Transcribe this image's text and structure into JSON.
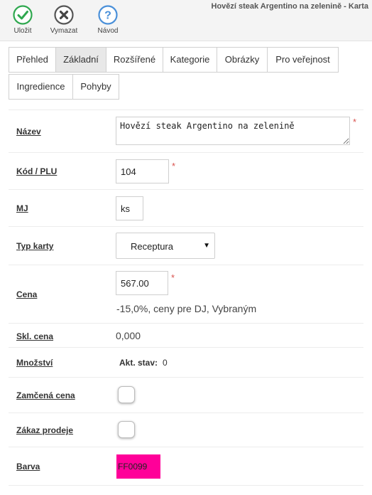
{
  "window": {
    "title": "Hovězí steak Argentino na zelenině - Karta"
  },
  "toolbar": {
    "save_label": "Uložit",
    "delete_label": "Vymazat",
    "help_label": "Návod"
  },
  "tabs": [
    {
      "label": "Přehled",
      "active": false
    },
    {
      "label": "Základní",
      "active": true
    },
    {
      "label": "Rozšířené",
      "active": false
    },
    {
      "label": "Kategorie",
      "active": false
    },
    {
      "label": "Obrázky",
      "active": false
    },
    {
      "label": "Pro veřejnost",
      "active": false
    },
    {
      "label": "Ingredience",
      "active": false
    },
    {
      "label": "Pohyby",
      "active": false
    }
  ],
  "form": {
    "name": {
      "label": "Název",
      "value": "Hovězí steak Argentino na zelenině",
      "required_mark": "*"
    },
    "code": {
      "label": "Kód / PLU",
      "value": "104",
      "required_mark": "*"
    },
    "unit": {
      "label": "MJ",
      "value": "ks"
    },
    "card_type": {
      "label": "Typ karty",
      "value": "Receptura",
      "options": [
        "Receptura"
      ]
    },
    "price": {
      "label": "Cena",
      "value": "567.00",
      "required_mark": "*",
      "note": "-15,0%, ceny pre DJ, Vybraným"
    },
    "stock_price": {
      "label": "Skl. cena",
      "value": "0,000"
    },
    "quantity": {
      "label": "Množství",
      "current_label": "Akt. stav:",
      "current_value": "0"
    },
    "locked_price": {
      "label": "Zamčená cena",
      "checked": false
    },
    "sale_ban": {
      "label": "Zákaz prodeje",
      "checked": false
    },
    "color": {
      "label": "Barva",
      "value": "FF0099",
      "swatch_hex": "#FF0099"
    }
  },
  "colors": {
    "save_icon": "#2fa84f",
    "delete_icon": "#555555",
    "help_icon": "#4a90d9",
    "required": "#d9534f"
  }
}
